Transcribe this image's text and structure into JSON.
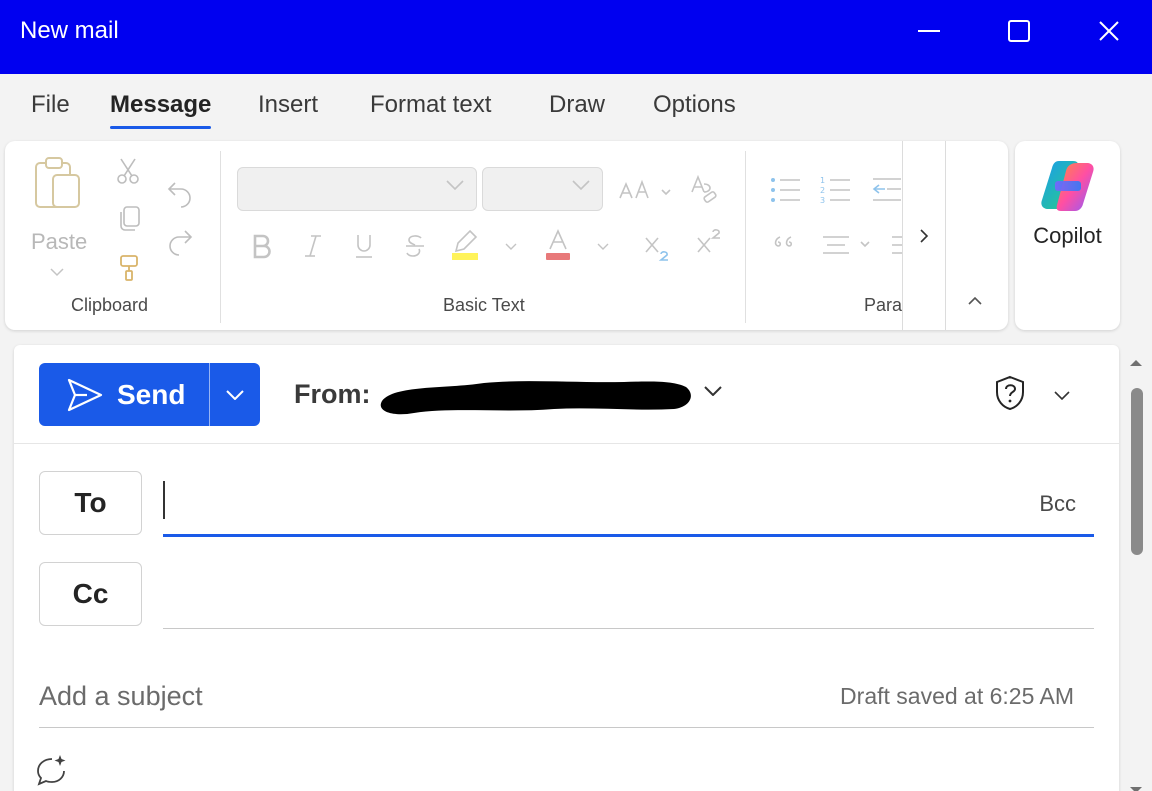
{
  "window": {
    "title": "New mail",
    "titlebar_color": "#0000f0"
  },
  "tabs": [
    {
      "label": "File"
    },
    {
      "label": "Message",
      "active": true
    },
    {
      "label": "Insert"
    },
    {
      "label": "Format text"
    },
    {
      "label": "Draw"
    },
    {
      "label": "Options"
    }
  ],
  "ribbon": {
    "clipboard": {
      "label": "Clipboard",
      "paste_label": "Paste"
    },
    "basic_text": {
      "label": "Basic Text",
      "font_name": "",
      "font_size": ""
    },
    "paragraph": {
      "label": "Parag"
    },
    "copilot": {
      "label": "Copilot"
    }
  },
  "compose": {
    "send_label": "Send",
    "from_label": "From:",
    "from_value_redacted": true,
    "to_label": "To",
    "cc_label": "Cc",
    "bcc_label": "Bcc",
    "to_value": "",
    "cc_value": "",
    "subject_placeholder": "Add a subject",
    "draft_status": "Draft saved at 6:25 AM"
  },
  "colors": {
    "accent": "#1a5ae8",
    "highlight_yellow": "#fff35a",
    "font_color_red": "#e8797a"
  }
}
